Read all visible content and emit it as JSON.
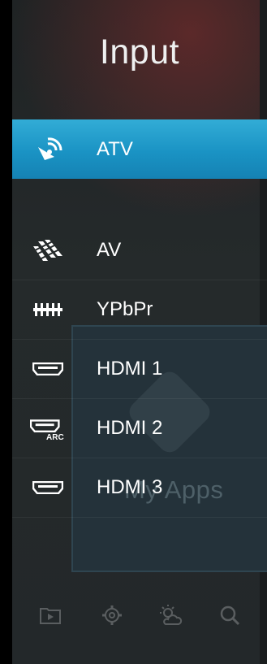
{
  "panel": {
    "title": "Input"
  },
  "inputs": [
    {
      "label": "ATV",
      "icon": "satellite-dish-icon",
      "selected": true
    },
    {
      "label": "AV",
      "icon": "av-cable-icon",
      "selected": false
    },
    {
      "label": "YPbPr",
      "icon": "component-connector-icon",
      "selected": false
    },
    {
      "label": "HDMI 1",
      "icon": "hdmi-port-icon",
      "selected": false
    },
    {
      "label": "HDMI 2",
      "icon": "hdmi-arc-port-icon",
      "selected": false,
      "badge": "ARC"
    },
    {
      "label": "HDMI 3",
      "icon": "hdmi-port-icon",
      "selected": false
    }
  ],
  "background": {
    "tile_label": "My Apps"
  },
  "dock": [
    "media-player-icon",
    "settings-gear-icon",
    "weather-icon",
    "search-icon"
  ],
  "colors": {
    "selected_highlight": "#1a93c4",
    "panel_background": "#23282a",
    "text": "#ffffff"
  }
}
